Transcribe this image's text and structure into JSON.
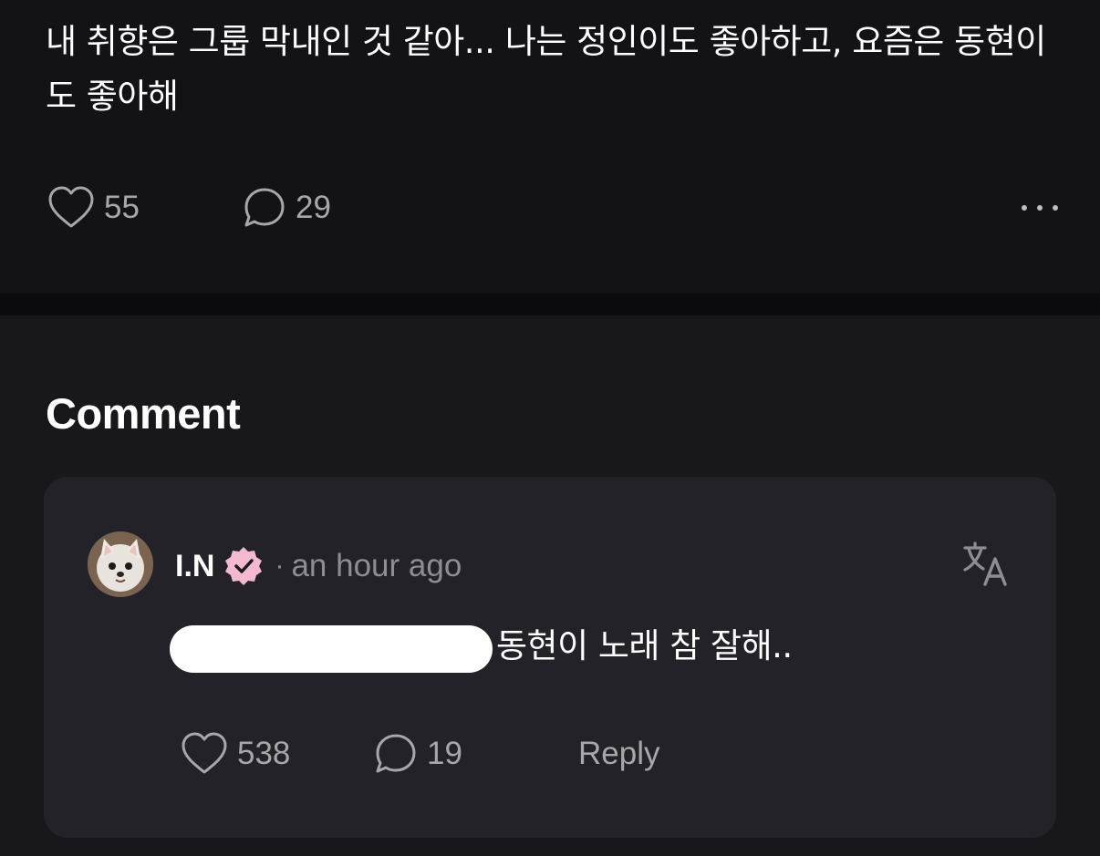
{
  "post": {
    "text": "내 취향은 그룹 막내인 것 같아... 나는 정인이도 좋아하고, 요즘은 동현이도 좋아해",
    "like_count": "55",
    "comment_count": "29"
  },
  "comments_section": {
    "title": "Comment",
    "items": [
      {
        "username": "I.N",
        "verified": true,
        "separator": "·",
        "time": "an hour ago",
        "text": "동현이 노래 참 잘해..",
        "like_count": "538",
        "reply_count": "19",
        "reply_label": "Reply"
      }
    ]
  },
  "colors": {
    "background": "#131217",
    "card": "#232228",
    "verified_badge": "#f4b8d0",
    "muted_text": "#a6a6ab"
  }
}
